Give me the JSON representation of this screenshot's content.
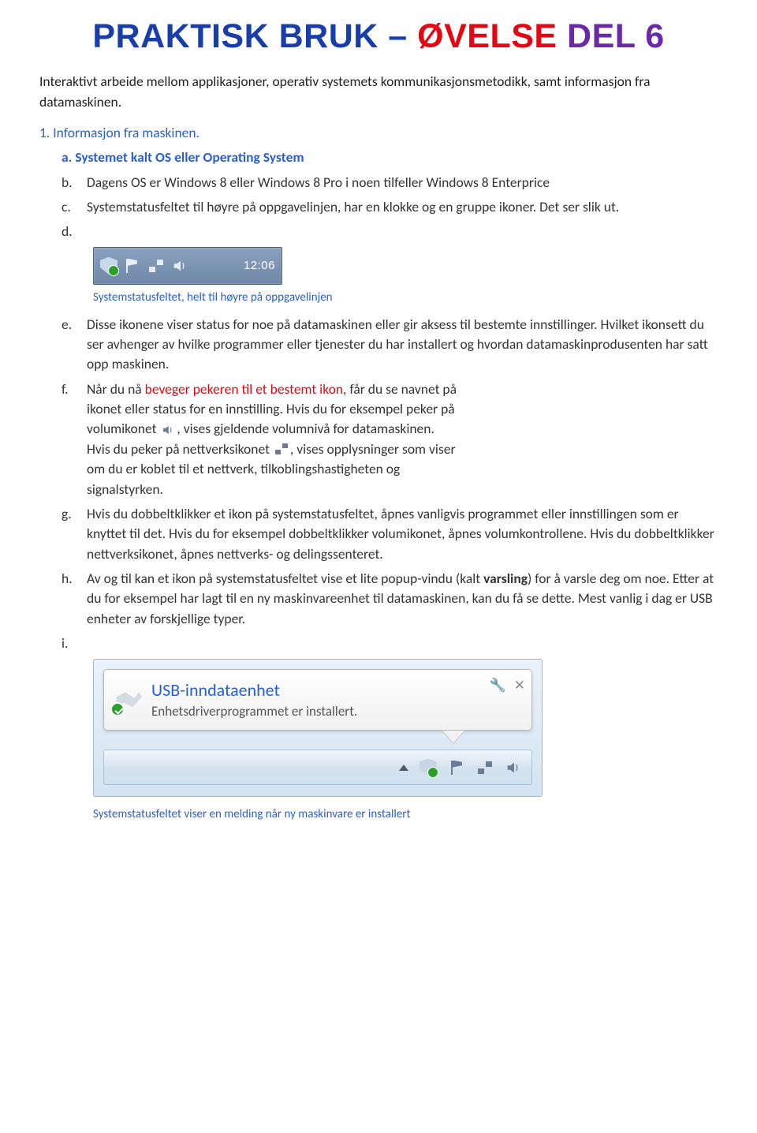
{
  "title": {
    "p1": "PRAKTISK BRUK –",
    "p2": "ØVELSE",
    "p3": "DEL 6"
  },
  "intro": "Interaktivt arbeide mellom applikasjoner, operativ systemets kommunikasjonsmetodikk, samt informasjon fra datamaskinen.",
  "sec1_label": "1.",
  "sec1_text": "Informasjon fra maskinen.",
  "items": {
    "a": {
      "label": "a.",
      "text": "Systemet kalt OS eller Operating System"
    },
    "b": {
      "label": "b.",
      "text": "Dagens OS er Windows 8 eller Windows 8 Pro i noen tilfeller Windows 8 Enterprice"
    },
    "c": {
      "label": "c.",
      "text": "Systemstatusfeltet til høyre på oppgavelinjen, har en klokke og en gruppe ikoner. Det ser slik ut."
    },
    "d": {
      "label": "d.",
      "caption": "Systemstatusfeltet, helt til høyre på oppgavelinjen",
      "clock": "12:06"
    },
    "e": {
      "label": "e.",
      "text": "Disse ikonene viser status for noe på datamaskinen eller gir aksess til bestemte innstillinger. Hvilket ikonsett du ser avhenger av hvilke programmer eller tjenester du har installert og hvordan datamaskinprodusenten har satt opp maskinen."
    },
    "f": {
      "label": "f.",
      "t1": "Når du nå ",
      "hl": "beveger pekeren til et bestemt ikon",
      "t2": ", får du se navnet på ikonet eller status for en innstilling. Hvis du for eksempel peker på volumikonet ",
      "t3": ", vises gjeldende volumnivå for datamaskinen. Hvis du peker på nettverksikonet ",
      "t4": ", vises opplysninger som viser om du er koblet til et nettverk, tilkoblingshastigheten og signalstyrken."
    },
    "g": {
      "label": "g.",
      "text": "Hvis du dobbeltklikker et ikon på systemstatusfeltet, åpnes vanligvis programmet eller innstillingen som er knyttet til det. Hvis du for eksempel dobbeltklikker volumikonet, åpnes volumkontrollene. Hvis du dobbeltklikker nettverksikonet, åpnes nettverks- og delingssenteret."
    },
    "h": {
      "label": "h.",
      "t1": "Av og til kan et ikon på systemstatusfeltet vise et lite popup-vindu (kalt ",
      "bold": "varsling",
      "t2": ") for å varsle deg om noe. Etter at du for eksempel har lagt til en ny maskinvareenhet til datamaskinen, kan du få se dette. Mest vanlig i dag er USB enheter av forskjellige typer."
    },
    "i": {
      "label": "i.",
      "balloon_title": "USB-inndataenhet",
      "balloon_text": "Enhetsdriverprogrammet er installert.",
      "caption": "Systemstatusfeltet viser en melding når ny maskinvare er installert"
    }
  }
}
